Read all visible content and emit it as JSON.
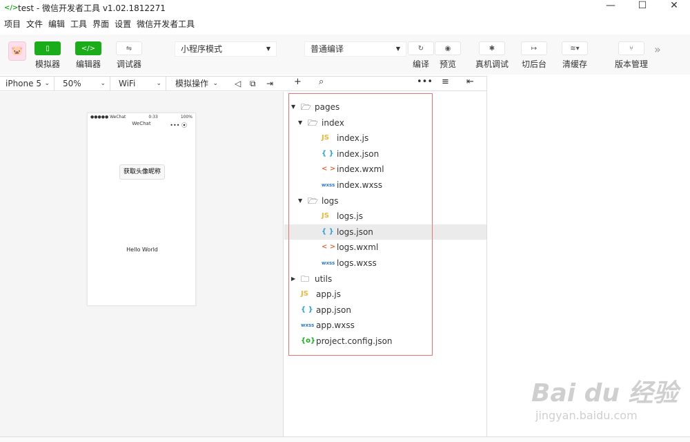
{
  "window": {
    "title": "test - 微信开发者工具 v1.02.1812271",
    "controls": [
      "—",
      "☐",
      "✕"
    ]
  },
  "menu": [
    "项目",
    "文件",
    "编辑",
    "工具",
    "界面",
    "设置",
    "微信开发者工具"
  ],
  "toolbar": {
    "simulator": "模拟器",
    "editor": "编辑器",
    "debugger": "调试器",
    "mode_select": "小程序模式",
    "compile_select": "普通编译",
    "compile": "编译",
    "preview": "预览",
    "remote_debug": "真机调试",
    "background": "切后台",
    "clear_cache": "清缓存",
    "version": "版本管理"
  },
  "subbar": {
    "device": "iPhone 5",
    "zoom": "50%",
    "network": "WiFi",
    "operation": "模拟操作"
  },
  "phone": {
    "carrier": "●●●●● WeChat",
    "time": "0:33",
    "battery": "100%",
    "nav_title": "WeChat",
    "button": "获取头像昵称",
    "hello": "Hello World"
  },
  "tree": [
    {
      "label": "pages",
      "kind": "folder",
      "open": true,
      "depth": 0
    },
    {
      "label": "index",
      "kind": "folder",
      "open": true,
      "depth": 1
    },
    {
      "label": "index.js",
      "kind": "js",
      "depth": 2
    },
    {
      "label": "index.json",
      "kind": "json",
      "depth": 2
    },
    {
      "label": "index.wxml",
      "kind": "wxml",
      "depth": 2
    },
    {
      "label": "index.wxss",
      "kind": "wxss",
      "depth": 2
    },
    {
      "label": "logs",
      "kind": "folder",
      "open": true,
      "depth": 1
    },
    {
      "label": "logs.js",
      "kind": "js",
      "depth": 2
    },
    {
      "label": "logs.json",
      "kind": "json",
      "depth": 2,
      "selected": true
    },
    {
      "label": "logs.wxml",
      "kind": "wxml",
      "depth": 2
    },
    {
      "label": "logs.wxss",
      "kind": "wxss",
      "depth": 2
    },
    {
      "label": "utils",
      "kind": "folder",
      "open": false,
      "depth": 0
    },
    {
      "label": "app.js",
      "kind": "js",
      "depth": 0
    },
    {
      "label": "app.json",
      "kind": "json",
      "depth": 0
    },
    {
      "label": "app.wxss",
      "kind": "wxss",
      "depth": 0
    },
    {
      "label": "project.config.json",
      "kind": "cfg",
      "depth": 0
    }
  ],
  "icon_glyphs": {
    "js": "JS",
    "json": "{ }",
    "wxml": "< >",
    "wxss": "wxss",
    "cfg": "{o}"
  },
  "watermark": {
    "brand": "Bai du 经验",
    "url": "jingyan.baidu.com"
  },
  "colors": {
    "accent": "#1aad19",
    "highlight_box": "#e57373",
    "selected_row": "#ebebeb"
  }
}
